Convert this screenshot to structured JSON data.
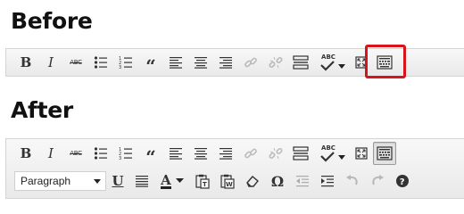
{
  "before": {
    "heading": "Before",
    "buttons": [
      {
        "name": "bold",
        "label": "B"
      },
      {
        "name": "italic",
        "label": "I"
      },
      {
        "name": "strikethrough",
        "label": "ABC"
      },
      {
        "name": "bullet-list",
        "label": ""
      },
      {
        "name": "numbered-list",
        "label": ""
      },
      {
        "name": "blockquote",
        "label": "“"
      },
      {
        "name": "align-left",
        "label": ""
      },
      {
        "name": "align-center",
        "label": ""
      },
      {
        "name": "align-right",
        "label": ""
      },
      {
        "name": "insert-link",
        "label": ""
      },
      {
        "name": "unlink",
        "label": ""
      },
      {
        "name": "insert-more",
        "label": ""
      },
      {
        "name": "spellcheck",
        "label": "ABC"
      },
      {
        "name": "fullscreen",
        "label": ""
      },
      {
        "name": "kitchen-sink",
        "label": ""
      }
    ]
  },
  "after": {
    "heading": "After",
    "row1": [
      {
        "name": "bold",
        "label": "B"
      },
      {
        "name": "italic",
        "label": "I"
      },
      {
        "name": "strikethrough",
        "label": "ABC"
      },
      {
        "name": "bullet-list",
        "label": ""
      },
      {
        "name": "numbered-list",
        "label": ""
      },
      {
        "name": "blockquote",
        "label": "“"
      },
      {
        "name": "align-left",
        "label": ""
      },
      {
        "name": "align-center",
        "label": ""
      },
      {
        "name": "align-right",
        "label": ""
      },
      {
        "name": "insert-link",
        "label": ""
      },
      {
        "name": "unlink",
        "label": ""
      },
      {
        "name": "insert-more",
        "label": ""
      },
      {
        "name": "spellcheck",
        "label": "ABC"
      },
      {
        "name": "fullscreen",
        "label": ""
      },
      {
        "name": "kitchen-sink",
        "label": ""
      }
    ],
    "format_select": {
      "value": "Paragraph"
    },
    "row2": [
      {
        "name": "underline",
        "label": "U"
      },
      {
        "name": "justify",
        "label": ""
      },
      {
        "name": "text-color",
        "label": "A"
      },
      {
        "name": "paste-as-text",
        "label": ""
      },
      {
        "name": "paste-from-word",
        "label": ""
      },
      {
        "name": "clear-formatting",
        "label": ""
      },
      {
        "name": "special-character",
        "label": "Ω"
      },
      {
        "name": "outdent",
        "label": ""
      },
      {
        "name": "indent",
        "label": ""
      },
      {
        "name": "undo",
        "label": ""
      },
      {
        "name": "redo",
        "label": ""
      },
      {
        "name": "help",
        "label": ""
      }
    ]
  },
  "colors": {
    "highlight": "#d8141b",
    "icon": "#333333",
    "icon_disabled": "#b9b9b9",
    "toolbar_bg": "#efefef"
  }
}
